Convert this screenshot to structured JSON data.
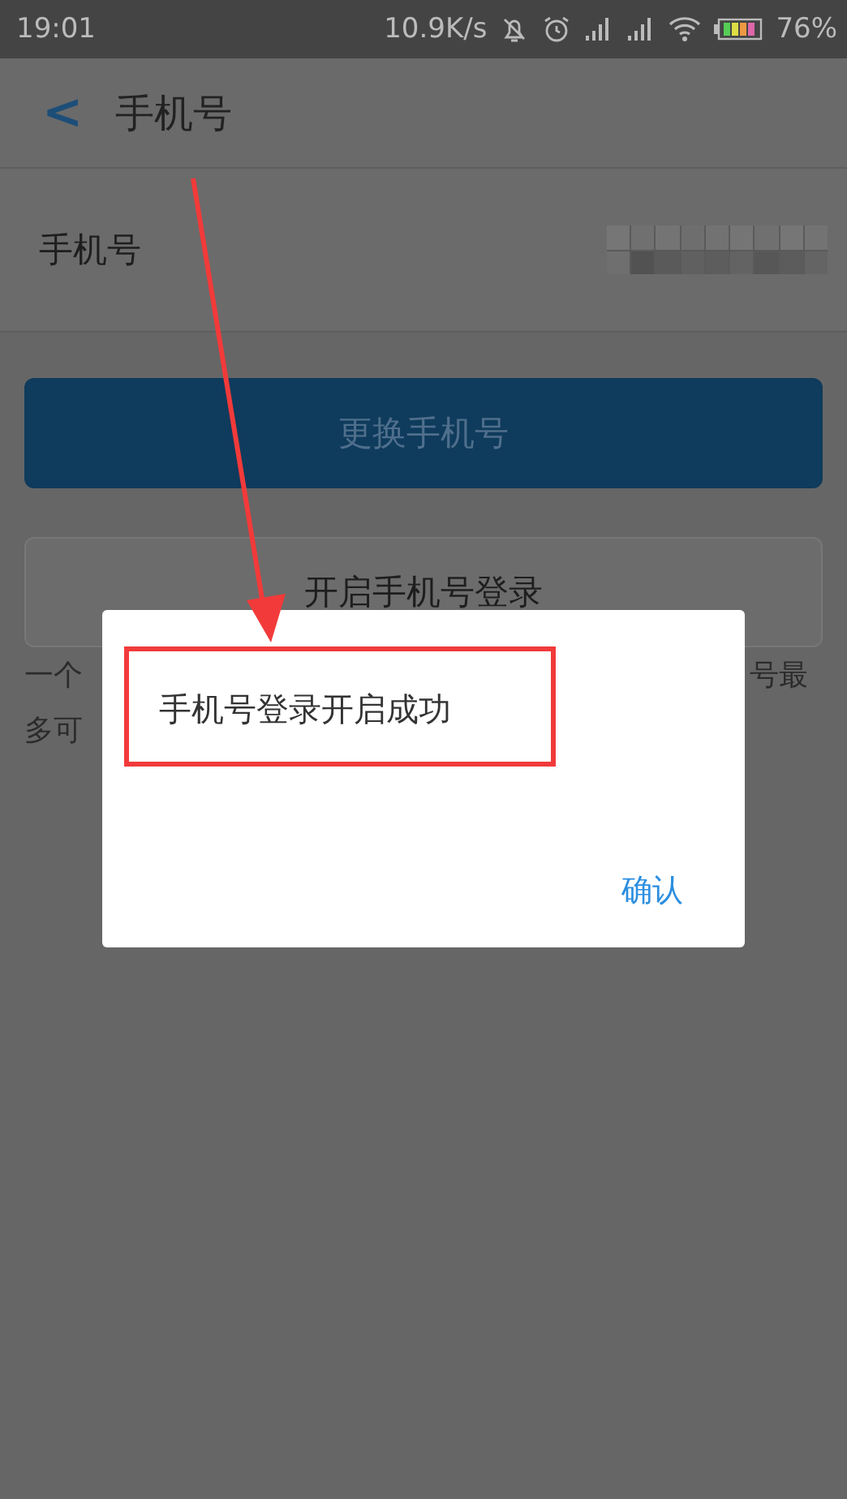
{
  "status_bar": {
    "time": "19:01",
    "net_speed": "10.9K/s",
    "battery": "76%"
  },
  "header": {
    "back": "<",
    "title": "手机号"
  },
  "phone_row": {
    "label": "手机号"
  },
  "change_button": "更换手机号",
  "enable_login_button": "开启手机号登录",
  "description": {
    "line_1_left": "一个",
    "line_1_right": "号最",
    "line_2_left": "多可"
  },
  "dialog": {
    "message": "手机号登录开启成功",
    "confirm": "确认"
  }
}
